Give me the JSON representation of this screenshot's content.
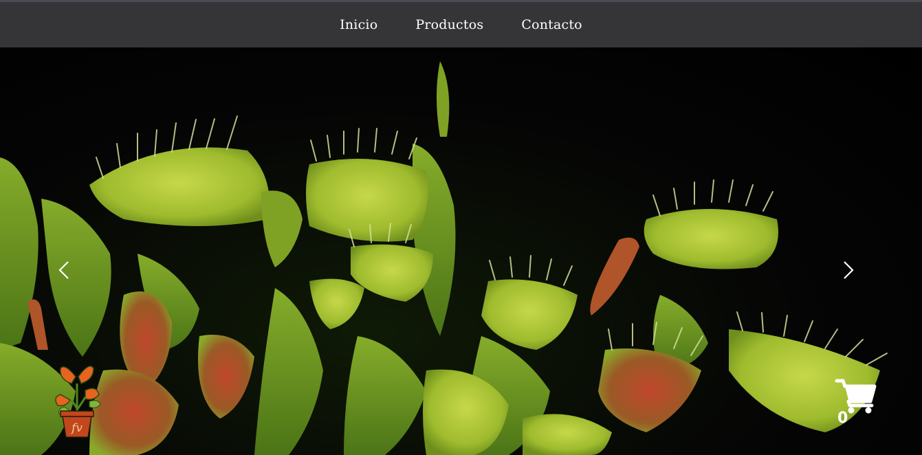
{
  "nav": {
    "items": [
      {
        "label": "Inicio"
      },
      {
        "label": "Productos"
      },
      {
        "label": "Contacto"
      }
    ]
  },
  "carousel": {
    "prev_icon": "chevron-left-icon",
    "next_icon": "chevron-right-icon"
  },
  "logo": {
    "text": "fv",
    "icon": "potted-flytrap-logo"
  },
  "cart": {
    "icon": "shopping-cart-icon",
    "count": "0"
  },
  "colors": {
    "navbar": "#353538",
    "background": "#000000",
    "trap_green": "#a9c43a",
    "trap_red": "#b8452a"
  }
}
